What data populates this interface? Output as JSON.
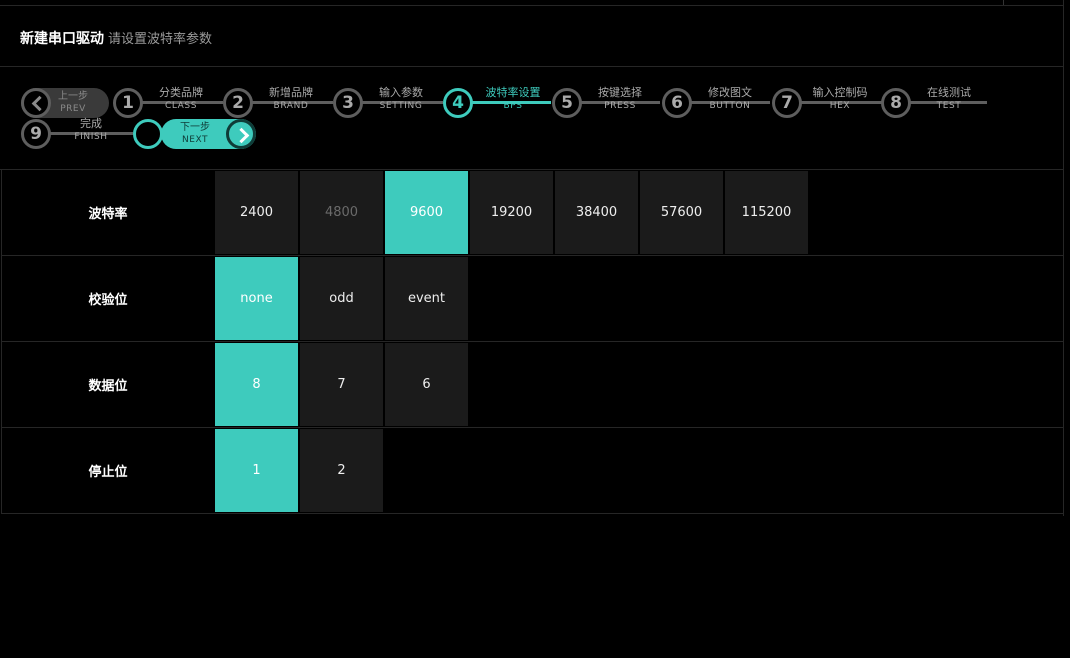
{
  "header": {
    "title": "新建串口驱动",
    "subtitle": "请设置波特率参数"
  },
  "wizard": {
    "prev": {
      "cn": "上一步",
      "en": "PREV"
    },
    "next": {
      "cn": "下一步",
      "en": "NEXT"
    },
    "steps": [
      {
        "num": "1",
        "cn": "分类品牌",
        "en": "CLASS"
      },
      {
        "num": "2",
        "cn": "新增品牌",
        "en": "BRAND"
      },
      {
        "num": "3",
        "cn": "输入参数",
        "en": "SETTING"
      },
      {
        "num": "4",
        "cn": "波特率设置",
        "en": "BPS"
      },
      {
        "num": "5",
        "cn": "按键选择",
        "en": "PRESS"
      },
      {
        "num": "6",
        "cn": "修改图文",
        "en": "BUTTON"
      },
      {
        "num": "7",
        "cn": "输入控制码",
        "en": "HEX"
      },
      {
        "num": "8",
        "cn": "在线测试",
        "en": "TEST"
      },
      {
        "num": "9",
        "cn": "完成",
        "en": "FINISH"
      }
    ],
    "active_step": "4"
  },
  "settings": {
    "baud": {
      "label": "波特率",
      "options": [
        "2400",
        "4800",
        "9600",
        "19200",
        "38400",
        "57600",
        "115200"
      ],
      "selected": "9600",
      "disabled": "4800"
    },
    "parity": {
      "label": "校验位",
      "options": [
        "none",
        "odd",
        "event"
      ],
      "selected": "none"
    },
    "databits": {
      "label": "数据位",
      "options": [
        "8",
        "7",
        "6"
      ],
      "selected": "8"
    },
    "stopbits": {
      "label": "停止位",
      "options": [
        "1",
        "2"
      ],
      "selected": "1"
    }
  },
  "colors": {
    "accent": "#3ecbbd",
    "cell": "#1b1b1b",
    "background": "#000000"
  }
}
